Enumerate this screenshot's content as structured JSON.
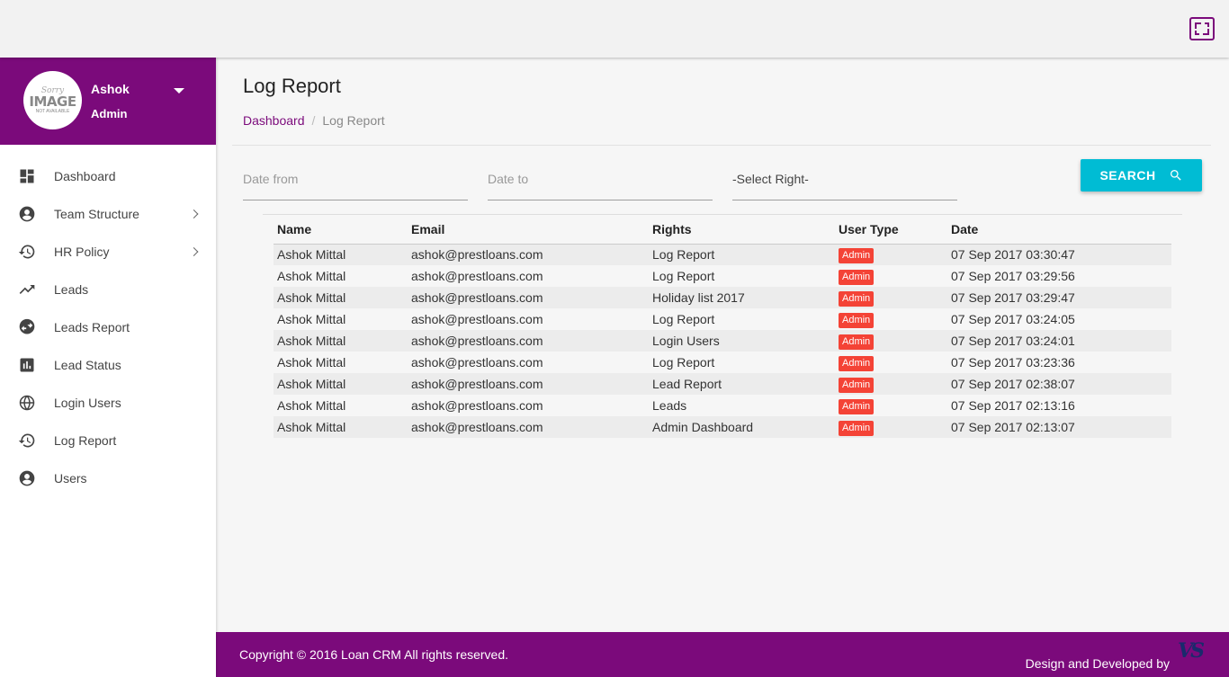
{
  "avatar": {
    "line1": "Sorry",
    "line2": "IMAGE",
    "line3": "NOT AVAILABLE"
  },
  "user": {
    "name": "Ashok",
    "role": "Admin"
  },
  "menu": [
    {
      "label": "Dashboard",
      "icon": "dashboard-icon"
    },
    {
      "label": "Team Structure",
      "icon": "account-circle-icon",
      "has_submenu": true
    },
    {
      "label": "HR Policy",
      "icon": "history-icon",
      "has_submenu": true
    },
    {
      "label": "Leads",
      "icon": "trending-up-icon"
    },
    {
      "label": "Leads Report",
      "icon": "swap-circle-icon"
    },
    {
      "label": "Lead Status",
      "icon": "bar-chart-icon"
    },
    {
      "label": "Login Users",
      "icon": "globe-icon"
    },
    {
      "label": "Log Report",
      "icon": "history-icon"
    },
    {
      "label": "Users",
      "icon": "account-circle-icon"
    }
  ],
  "page": {
    "title": "Log Report"
  },
  "breadcrumb": {
    "home": "Dashboard",
    "current": "Log Report"
  },
  "filters": {
    "date_from_placeholder": "Date from",
    "date_to_placeholder": "Date to",
    "select_right": "-Select Right-",
    "search_label": "SEARCH"
  },
  "table": {
    "headers": [
      "Name",
      "Email",
      "Rights",
      "User Type",
      "Date"
    ],
    "rows": [
      {
        "name": "Ashok Mittal",
        "email": "ashok@prestloans.com",
        "rights": "Log Report",
        "user_type": "Admin",
        "date": "07 Sep 2017 03:30:47"
      },
      {
        "name": "Ashok Mittal",
        "email": "ashok@prestloans.com",
        "rights": "Log Report",
        "user_type": "Admin",
        "date": "07 Sep 2017 03:29:56"
      },
      {
        "name": "Ashok Mittal",
        "email": "ashok@prestloans.com",
        "rights": "Holiday list 2017",
        "user_type": "Admin",
        "date": "07 Sep 2017 03:29:47"
      },
      {
        "name": "Ashok Mittal",
        "email": "ashok@prestloans.com",
        "rights": "Log Report",
        "user_type": "Admin",
        "date": "07 Sep 2017 03:24:05"
      },
      {
        "name": "Ashok Mittal",
        "email": "ashok@prestloans.com",
        "rights": "Login Users",
        "user_type": "Admin",
        "date": "07 Sep 2017 03:24:01"
      },
      {
        "name": "Ashok Mittal",
        "email": "ashok@prestloans.com",
        "rights": "Log Report",
        "user_type": "Admin",
        "date": "07 Sep 2017 03:23:36"
      },
      {
        "name": "Ashok Mittal",
        "email": "ashok@prestloans.com",
        "rights": "Lead Report",
        "user_type": "Admin",
        "date": "07 Sep 2017 02:38:07"
      },
      {
        "name": "Ashok Mittal",
        "email": "ashok@prestloans.com",
        "rights": "Leads",
        "user_type": "Admin",
        "date": "07 Sep 2017 02:13:16"
      },
      {
        "name": "Ashok Mittal",
        "email": "ashok@prestloans.com",
        "rights": "Admin Dashboard",
        "user_type": "Admin",
        "date": "07 Sep 2017 02:13:07"
      }
    ]
  },
  "footer": {
    "copyright": "Copyright © 2016 Loan CRM All rights reserved.",
    "credit": "Design and Developed by",
    "logo_text": "VS"
  },
  "colors": {
    "brand": "#7b0a7b",
    "accent": "#00bcd4",
    "badge": "#f44336"
  }
}
